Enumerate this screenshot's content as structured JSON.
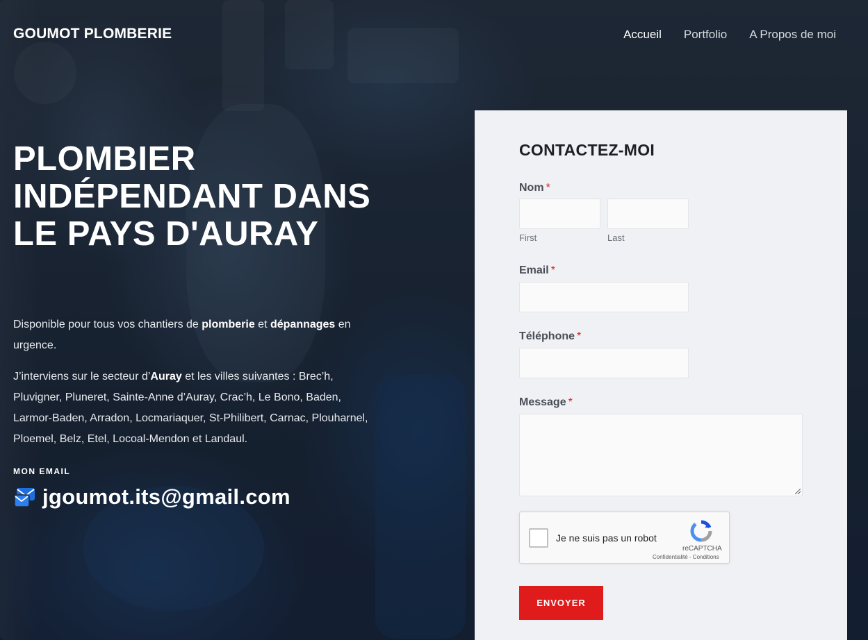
{
  "header": {
    "brand": "GOUMOT PLOMBERIE",
    "nav": [
      {
        "label": "Accueil",
        "active": true
      },
      {
        "label": "Portfolio",
        "active": false
      },
      {
        "label": "A Propos de moi",
        "active": false
      }
    ]
  },
  "hero": {
    "title": "PLOMBIER INDÉPENDANT DANS LE PAYS D'AURAY",
    "p1": {
      "t1": "Disponible pour tous vos chantiers de ",
      "b1": "plomberie",
      "t2": " et ",
      "b2": "dépannages",
      "t3": " en urgence."
    },
    "p2": {
      "t1": "J’interviens sur le secteur d’",
      "b1": "Auray",
      "t2": " et les villes suivantes : Brec’h, Pluvigner, Pluneret, Sainte-Anne d’Auray, Crac’h, Le Bono, Baden, Larmor-Baden, Arradon, Locmariaquer, St-Philibert, Carnac, Plouharnel, Ploemel, Belz, Etel, Locoal-Mendon et Landaul."
    },
    "email_label": "MON EMAIL",
    "email": "jgoumot.its@gmail.com",
    "email_icon": "mail-icon"
  },
  "form": {
    "title": "CONTACTEZ-MOI",
    "required_mark": "*",
    "name_label": "Nom",
    "first_sublabel": "First",
    "last_sublabel": "Last",
    "email_label": "Email",
    "phone_label": "Téléphone",
    "message_label": "Message",
    "recaptcha": {
      "label": "Je ne suis pas un robot",
      "brand": "reCAPTCHA",
      "links": "Confidentialité - Conditions"
    },
    "submit_label": "ENVOYER"
  },
  "colors": {
    "accent": "#e01b1b",
    "panel_bg": "#f0f1f5",
    "email_icon": "#1d6fe0"
  }
}
